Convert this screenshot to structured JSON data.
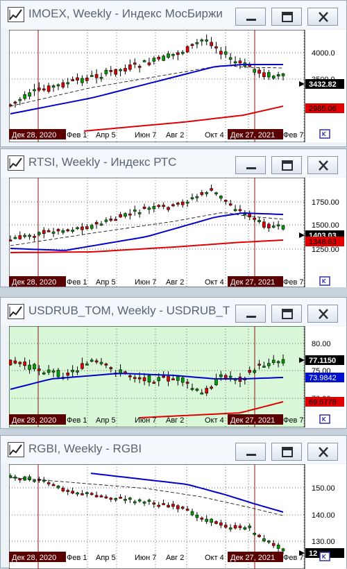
{
  "windows": [
    {
      "title": "IMOEX, Weekly - Индекс МосБиржи",
      "icon": "chart-line-icon",
      "background": "#ffffff",
      "price_labels": [
        {
          "value": "4000.0",
          "role": "axis"
        },
        {
          "value": "3500.0",
          "role": "axis"
        },
        {
          "value": "3432.82",
          "role": "last-price"
        },
        {
          "value": "2985.06",
          "role": "indicator"
        }
      ],
      "date_labels": [
        "Дек 28, 2020",
        "Фев 1",
        "Апр 5",
        "Июн 7",
        "Авг 2",
        "Окт 4",
        "Дек 27, 2021",
        "Фев 7"
      ]
    },
    {
      "title": "RTSI, Weekly - Индекс РТС",
      "icon": "chart-line-icon",
      "background": "#ffffff",
      "price_labels": [
        {
          "value": "1750.00",
          "role": "axis"
        },
        {
          "value": "1500.00",
          "role": "axis"
        },
        {
          "value": "1403.03",
          "role": "last-price"
        },
        {
          "value": "1348.63",
          "role": "indicator"
        },
        {
          "value": "1250.00",
          "role": "axis"
        }
      ],
      "date_labels": [
        "Дек 28, 2020",
        "Фев 1",
        "Апр 5",
        "Июн 7",
        "Авг 2",
        "Окт 4",
        "Дек 27, 2021",
        "Фев 7"
      ]
    },
    {
      "title": "USDRUB_TOM, Weekly - USDRUB_TOM",
      "icon": "chart-line-icon",
      "background": "#d8f8d8",
      "price_labels": [
        {
          "value": "80.00",
          "role": "axis"
        },
        {
          "value": "77.1150",
          "role": "last-price"
        },
        {
          "value": "75.00",
          "role": "axis"
        },
        {
          "value": "73.9842",
          "role": "ma-blue"
        },
        {
          "value": "70.00",
          "role": "axis"
        },
        {
          "value": "69.5778",
          "role": "indicator"
        }
      ],
      "date_labels": [
        "Дек 28, 2020",
        "Фев 1",
        "Апр 5",
        "Июн 7",
        "Авг 2",
        "Окт 4",
        "Дек 27, 2021",
        "Фев 7"
      ]
    },
    {
      "title": "RGBI, Weekly - RGBI",
      "icon": "chart-line-icon",
      "background": "#ffffff",
      "price_labels": [
        {
          "value": "150.00",
          "role": "axis"
        },
        {
          "value": "140.00",
          "role": "axis"
        },
        {
          "value": "130.00",
          "role": "axis"
        },
        {
          "value": "12",
          "role": "last-price"
        }
      ],
      "date_labels": [
        "Дек 28, 2020",
        "Фев 1",
        "Апр 5",
        "Июн 7",
        "Авг 2",
        "Окт 4",
        "Дек 27, 2021",
        "Фев 7"
      ]
    }
  ],
  "controls": {
    "minimize": "minimize-icon",
    "maximize": "maximize-icon",
    "close": "close-icon"
  },
  "colors": {
    "up": "#00a000",
    "down": "#e00000",
    "ma_blue": "#0000cc",
    "ma_red": "#e00000",
    "label_dark": "#5a0000"
  }
}
